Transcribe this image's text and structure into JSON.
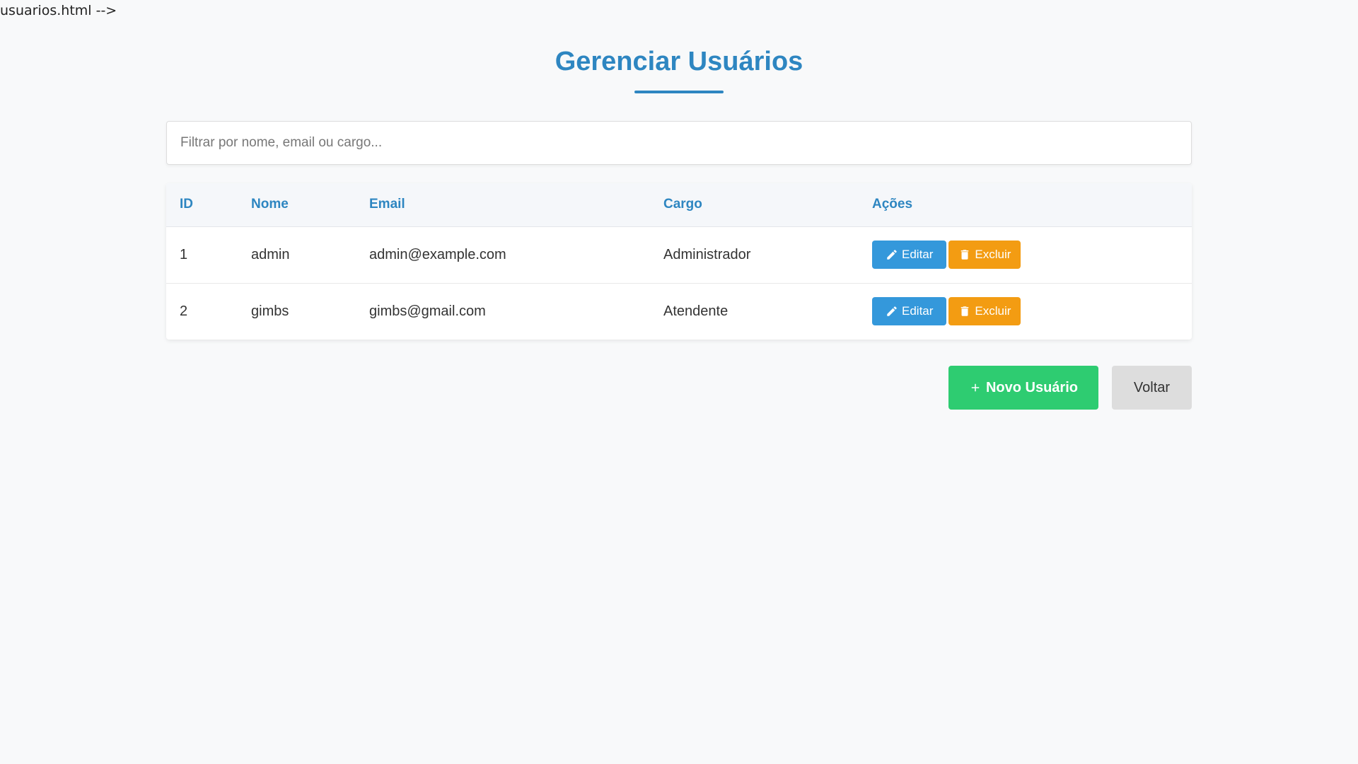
{
  "stray_text": "usuarios.html -->",
  "page": {
    "title": "Gerenciar Usuários"
  },
  "search": {
    "placeholder": "Filtrar por nome, email ou cargo..."
  },
  "table": {
    "headers": {
      "id": "ID",
      "nome": "Nome",
      "email": "Email",
      "cargo": "Cargo",
      "acoes": "Ações"
    },
    "rows": [
      {
        "id": "1",
        "nome": "admin",
        "email": "admin@example.com",
        "cargo": "Administrador",
        "edit_label": "Editar",
        "delete_label": "Excluir"
      },
      {
        "id": "2",
        "nome": "gimbs",
        "email": "gimbs@gmail.com",
        "cargo": "Atendente",
        "edit_label": "Editar",
        "delete_label": "Excluir"
      }
    ]
  },
  "footer_actions": {
    "new_user_label": "Novo Usuário",
    "back_label": "Voltar"
  },
  "colors": {
    "primary": "#2e86c1",
    "edit": "#3498db",
    "delete": "#f39c12",
    "new": "#2ecc71",
    "back": "#dddddd"
  },
  "icons": {
    "edit": "edit-icon",
    "delete": "trash-icon",
    "new": "plus-icon"
  }
}
